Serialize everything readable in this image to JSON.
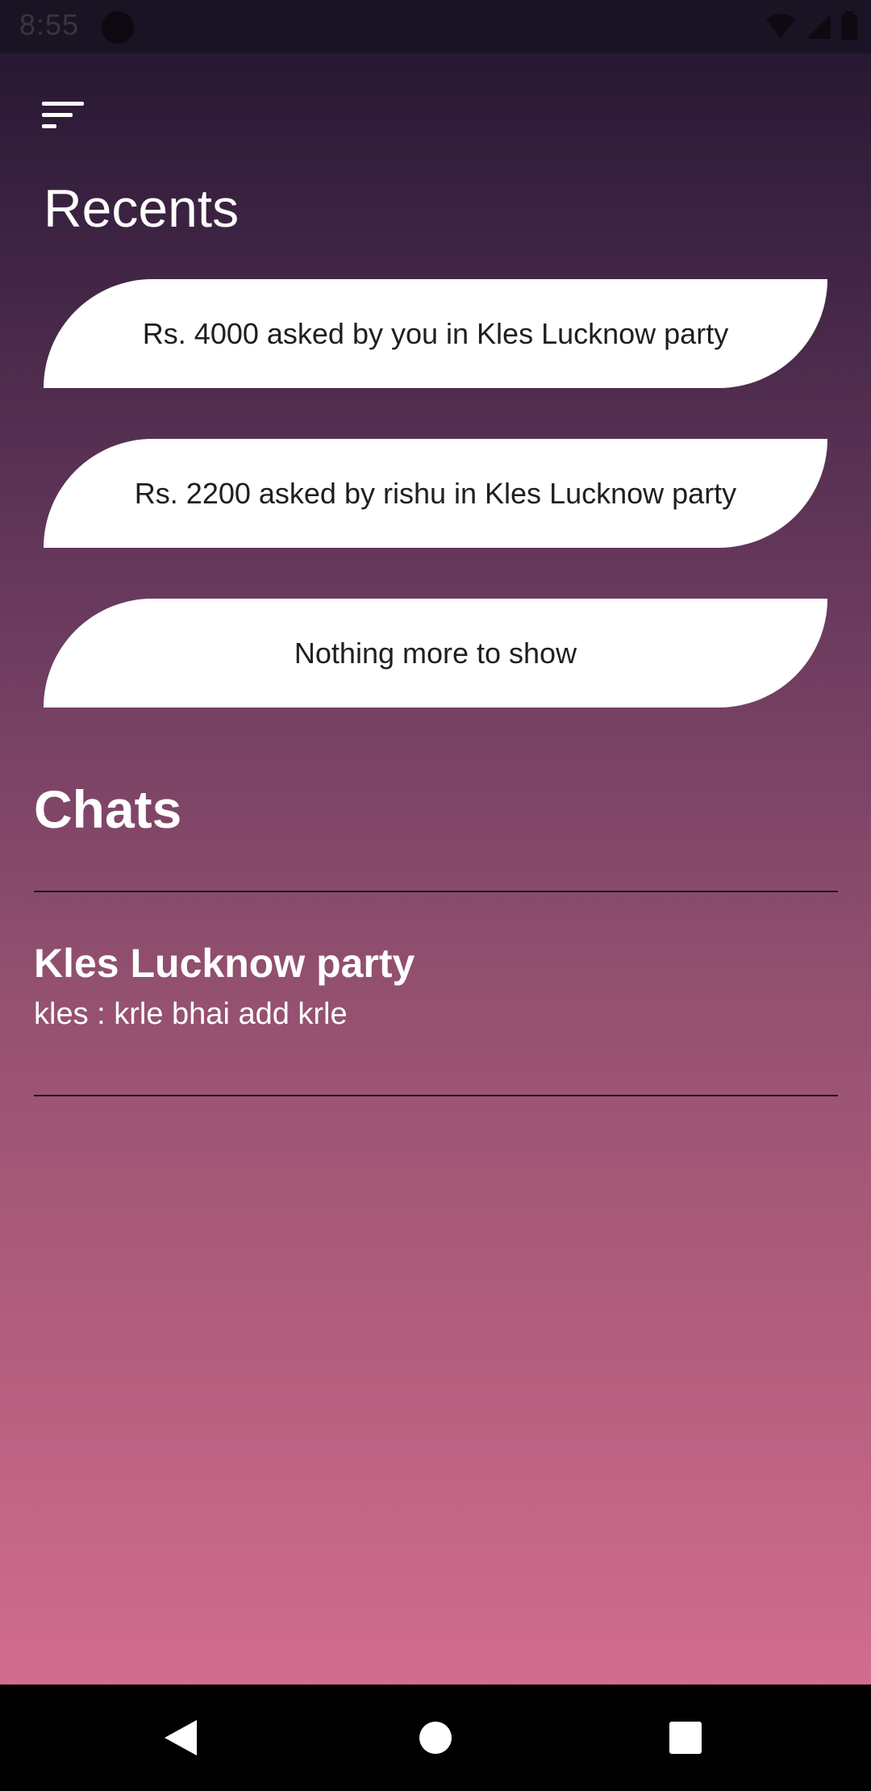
{
  "status_bar": {
    "time": "8:55",
    "icons": [
      "app-notification-icon",
      "wifi-icon",
      "signal-icon",
      "battery-icon"
    ]
  },
  "toolbar": {
    "menu_icon": "sort-menu-icon"
  },
  "recents": {
    "title": "Recents",
    "items": [
      {
        "text": "Rs. 4000 asked by you in Kles Lucknow party"
      },
      {
        "text": "Rs. 2200 asked by rishu in Kles Lucknow party"
      },
      {
        "text": "Nothing more to show"
      }
    ]
  },
  "chats": {
    "title": "Chats",
    "items": [
      {
        "name": "Kles Lucknow party",
        "last_message": "kles : krle bhai add krle"
      }
    ]
  },
  "nav_bar": {
    "icons": [
      "back-icon",
      "home-icon",
      "recents-icon"
    ]
  },
  "colors": {
    "gradient_top": "#22152e",
    "gradient_bottom": "#db7196",
    "card": "#ffffff",
    "divider": "#221420"
  }
}
